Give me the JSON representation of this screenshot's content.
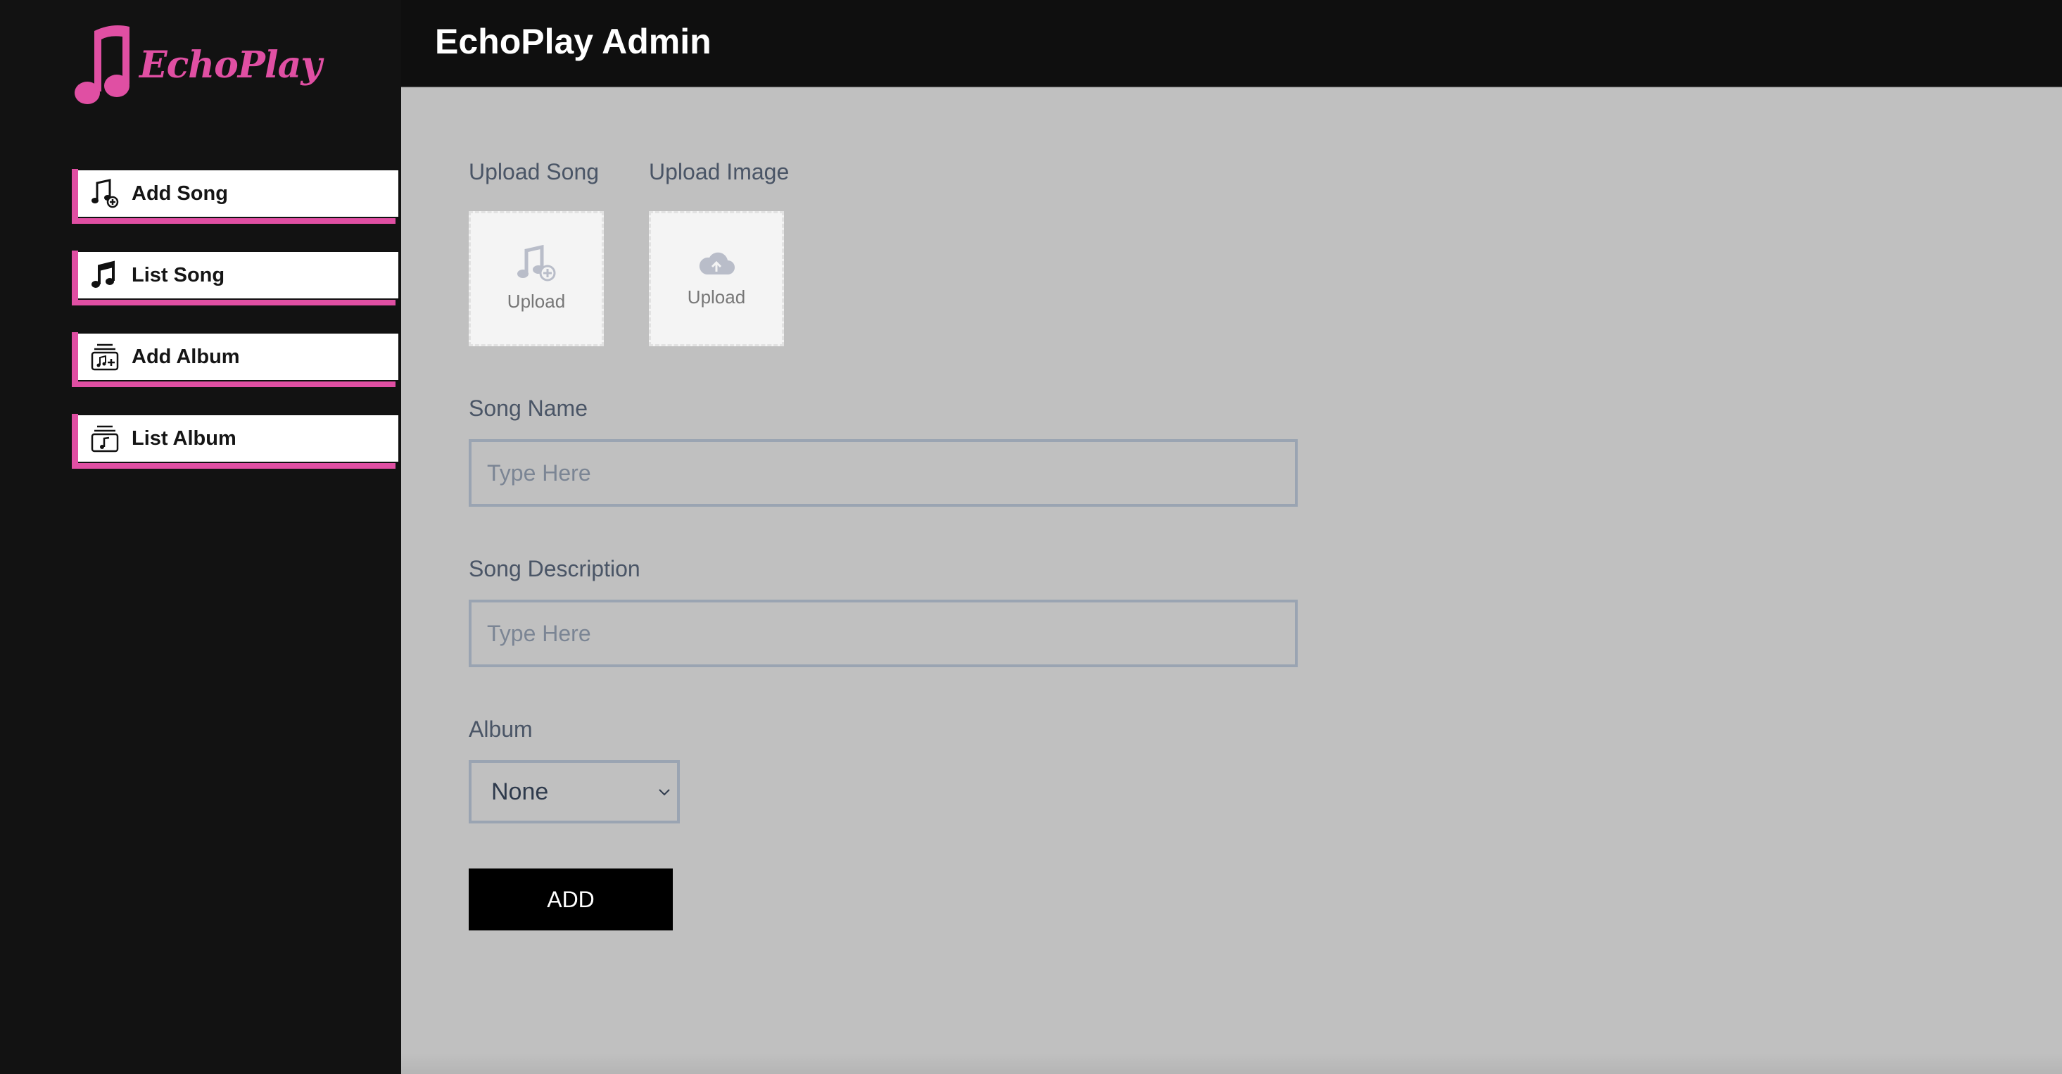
{
  "app": {
    "logo_text": "EchoPlay",
    "header_title": "EchoPlay Admin"
  },
  "colors": {
    "accent": "#e04fa3",
    "sidebar_bg": "#121212",
    "main_bg": "#c0c0c0",
    "button_bg": "#000000"
  },
  "sidebar": {
    "items": [
      {
        "label": "Add Song",
        "icon": "add-song-icon"
      },
      {
        "label": "List Song",
        "icon": "music-note-icon"
      },
      {
        "label": "Add Album",
        "icon": "add-album-icon"
      },
      {
        "label": "List Album",
        "icon": "album-icon"
      }
    ]
  },
  "form": {
    "upload_song": {
      "label": "Upload Song",
      "button_text": "Upload",
      "icon": "music-add-icon"
    },
    "upload_image": {
      "label": "Upload Image",
      "button_text": "Upload",
      "icon": "cloud-upload-icon"
    },
    "song_name": {
      "label": "Song Name",
      "placeholder": "Type Here",
      "value": ""
    },
    "song_description": {
      "label": "Song Description",
      "placeholder": "Type Here",
      "value": ""
    },
    "album": {
      "label": "Album",
      "selected": "None"
    },
    "submit_label": "ADD"
  }
}
